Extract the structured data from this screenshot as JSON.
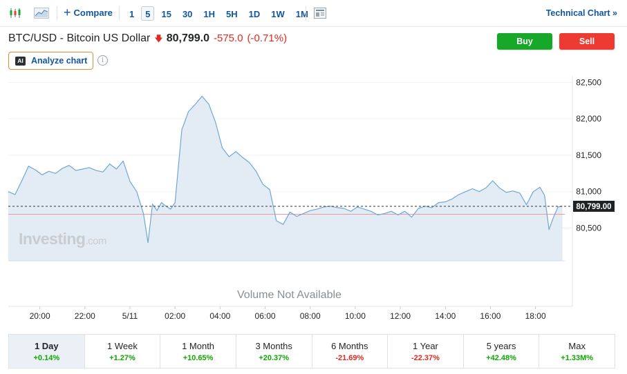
{
  "toolbar": {
    "compare_label": "Compare",
    "intervals": [
      "1",
      "5",
      "15",
      "30",
      "1H",
      "5H",
      "1D",
      "1W",
      "1M"
    ],
    "active_interval": "5",
    "technical_label": "Technical Chart »"
  },
  "header": {
    "symbol": "BTC/USD - Bitcoin US Dollar",
    "price": "80,799.0",
    "change": "-575.0",
    "change_pct": "(-0.71%)",
    "buy_label": "Buy",
    "sell_label": "Sell",
    "analyze_label": "Analyze chart",
    "ai_badge": "AI",
    "info_glyph": "i"
  },
  "watermark": {
    "brand": "Investing",
    "suffix": ".com"
  },
  "volume_label": "Volume Not Available",
  "colors": {
    "line": "#6fa6d6",
    "area": "#e3ecf4",
    "prev_close": "#e89a9a",
    "buy": "#17a829",
    "sell": "#ed3b33",
    "up": "#0ea600",
    "down": "#dd2b1f"
  },
  "chart_data": {
    "type": "area",
    "y_ticks": [
      "82,500",
      "82,000",
      "81,500",
      "81,000",
      "80,500"
    ],
    "y_tick_values": [
      82500,
      82000,
      81500,
      81000,
      80500
    ],
    "ylim": [
      80050,
      82570
    ],
    "x_ticks": [
      "20:00",
      "22:00",
      "5/11",
      "02:00",
      "04:00",
      "06:00",
      "08:00",
      "10:00",
      "12:00",
      "14:00",
      "16:00",
      "18:00"
    ],
    "x_tick_hours": [
      20,
      22,
      24,
      26,
      28,
      30,
      32,
      34,
      36,
      38,
      40,
      42
    ],
    "xlim_hours": [
      18.6,
      43.3
    ],
    "last_price_label": "80,799.00",
    "last_price": 80799,
    "prev_close": 80690,
    "grid": "horizontal",
    "series": [
      {
        "x_hours": [
          18.6,
          18.9,
          19.2,
          19.5,
          19.8,
          20.1,
          20.4,
          20.7,
          21.0,
          21.3,
          21.6,
          21.9,
          22.2,
          22.5,
          22.8,
          23.1,
          23.4,
          23.7,
          24.0,
          24.3,
          24.6,
          24.8,
          25.0,
          25.2,
          25.4,
          25.6,
          25.8,
          26.0,
          26.3,
          26.6,
          26.9,
          27.2,
          27.5,
          27.8,
          28.1,
          28.4,
          28.7,
          29.0,
          29.3,
          29.6,
          29.9,
          30.2,
          30.5,
          30.8,
          31.1,
          31.4,
          31.7,
          32.0,
          32.3,
          32.6,
          32.9,
          33.2,
          33.5,
          33.8,
          34.1,
          34.4,
          34.7,
          35.0,
          35.3,
          35.6,
          35.9,
          36.2,
          36.5,
          36.8,
          37.1,
          37.4,
          37.7,
          38.0,
          38.3,
          38.6,
          38.9,
          39.2,
          39.5,
          39.8,
          40.1,
          40.4,
          40.7,
          41.0,
          41.3,
          41.6,
          41.9,
          42.2,
          42.4,
          42.6,
          42.8,
          43.0,
          43.2
        ],
        "values": [
          81000,
          80960,
          81150,
          81350,
          81300,
          81230,
          81280,
          81250,
          81320,
          81360,
          81290,
          81310,
          81330,
          81290,
          81270,
          81380,
          81310,
          81420,
          81140,
          81000,
          80700,
          80300,
          80830,
          80740,
          80850,
          80800,
          80760,
          80850,
          81850,
          82100,
          82200,
          82310,
          82200,
          81950,
          81600,
          81480,
          81550,
          81470,
          81400,
          81280,
          81100,
          81030,
          80600,
          80550,
          80720,
          80660,
          80700,
          80740,
          80760,
          80790,
          80800,
          80780,
          80770,
          80730,
          80790,
          80760,
          80730,
          80680,
          80700,
          80730,
          80680,
          80730,
          80650,
          80770,
          80800,
          80780,
          80850,
          80860,
          80900,
          80960,
          81000,
          81040,
          81000,
          81050,
          81150,
          81050,
          80990,
          81010,
          80980,
          80820,
          81000,
          81060,
          80950,
          80480,
          80650,
          80790,
          80800
        ]
      }
    ]
  },
  "periods": [
    {
      "label": "1 Day",
      "change": "+0.14%",
      "dir": "up"
    },
    {
      "label": "1 Week",
      "change": "+1.27%",
      "dir": "up"
    },
    {
      "label": "1 Month",
      "change": "+10.65%",
      "dir": "up"
    },
    {
      "label": "3 Months",
      "change": "+20.37%",
      "dir": "up"
    },
    {
      "label": "6 Months",
      "change": "-21.69%",
      "dir": "down"
    },
    {
      "label": "1 Year",
      "change": "-22.37%",
      "dir": "down"
    },
    {
      "label": "5 years",
      "change": "+42.48%",
      "dir": "up"
    },
    {
      "label": "Max",
      "change": "+1.33M%",
      "dir": "up"
    }
  ],
  "active_period": "1 Day"
}
